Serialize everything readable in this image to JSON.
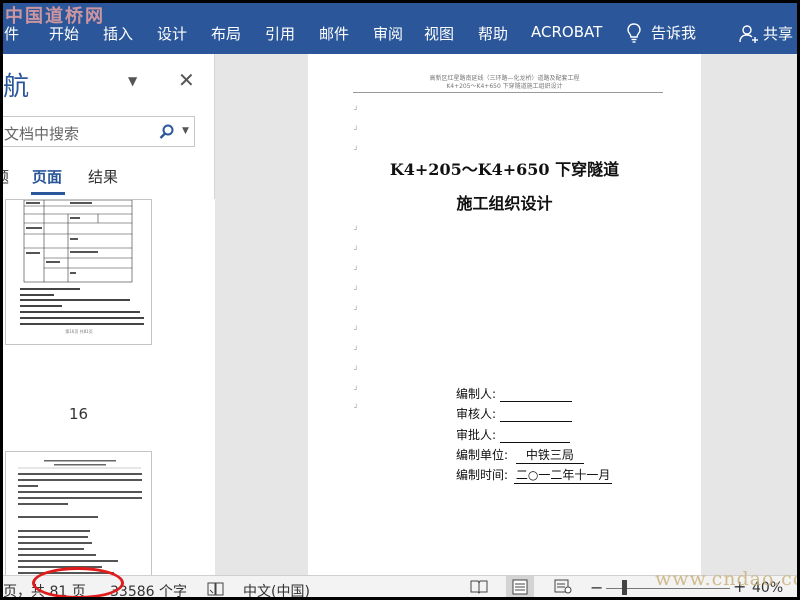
{
  "watermark_top": "中国道桥网",
  "watermark_bottom": "www.cndao.com",
  "ribbon": {
    "tabs": [
      "件",
      "开始",
      "插入",
      "设计",
      "布局",
      "引用",
      "邮件",
      "审阅",
      "视图",
      "帮助",
      "ACROBAT"
    ],
    "tell_me": "告诉我",
    "share": "共享",
    "colors": {
      "ribbon_bg": "#2b579a"
    }
  },
  "nav": {
    "title": "航",
    "search_placeholder": "文档中搜索",
    "tabs": [
      "题",
      "页面",
      "结果"
    ],
    "active_tab": "页面",
    "thumbnail_page_number": "16",
    "thumb1_caption": "第16页 共81页"
  },
  "doc": {
    "header_line1": "高新区红星路南延线（三环路—化龙桥）道路及配套工程",
    "header_line2": "K4+205～K4+650 下穿隧道施工组织设计",
    "title_line1": "K4+205～K4+650 下穿隧道",
    "title_line2": "施工组织设计",
    "fields": {
      "editor": "编制人:",
      "reviewer": "审核人:",
      "approver": "审批人:",
      "unit_label": "编制单位:",
      "unit_value": "中铁三局",
      "date_label": "编制时间:",
      "date_value": "二○一二年十一月"
    }
  },
  "status": {
    "page_info": "页，共 81 页",
    "word_count": "33586 个字",
    "language": "中文(中国)",
    "zoom_minus": "−",
    "zoom_plus": "+",
    "zoom": "40%",
    "zoom_level_percent": 40,
    "colors": {
      "annotation": "#e01b1b"
    }
  }
}
